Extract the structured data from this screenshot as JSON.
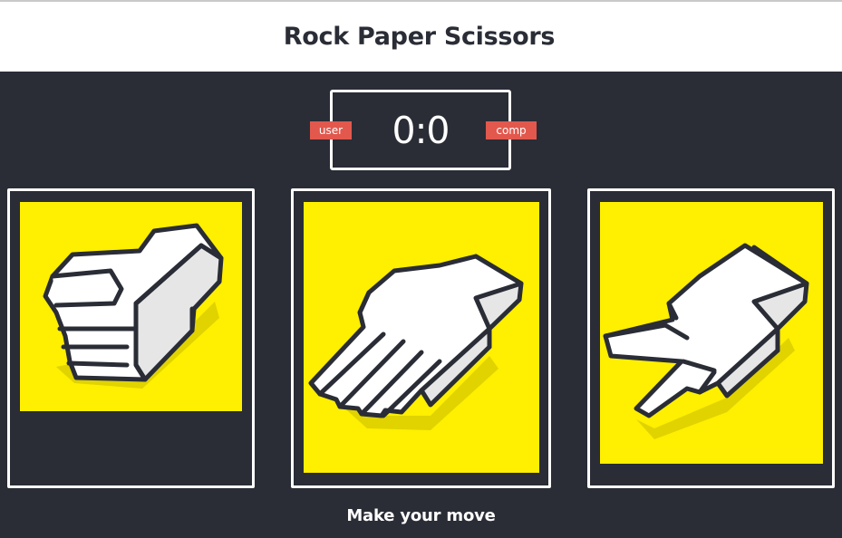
{
  "header": {
    "title": "Rock Paper Scissors"
  },
  "scoreboard": {
    "user_label": "user",
    "comp_label": "comp",
    "score": "0:0"
  },
  "choices": [
    {
      "id": "rock",
      "icon": "rock-hand-icon"
    },
    {
      "id": "paper",
      "icon": "paper-hand-icon"
    },
    {
      "id": "scissors",
      "icon": "scissors-hand-icon"
    }
  ],
  "message": "Make your move",
  "colors": {
    "background": "#2a2d36",
    "header_bg": "#ffffff",
    "tile_yellow": "#ffef00",
    "badge_red": "#e2584d",
    "hand_white": "#ffffff",
    "outline": "#2a2d36"
  }
}
